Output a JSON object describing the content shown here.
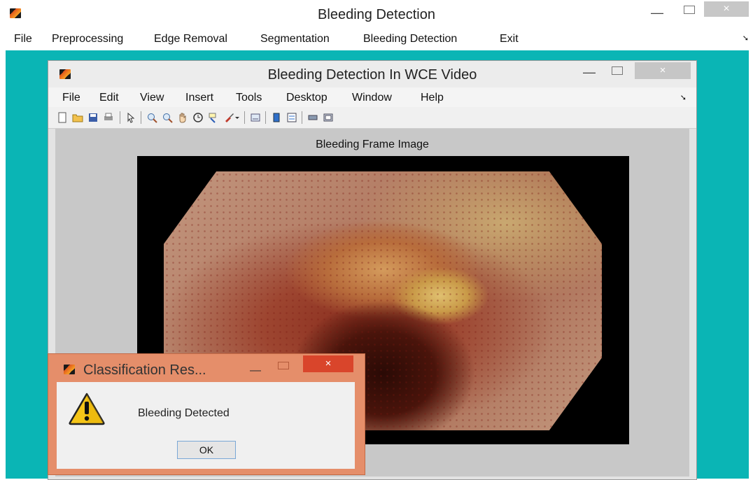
{
  "main_window": {
    "title": "Bleeding Detection",
    "close_glyph": "×",
    "minimize_glyph": "—",
    "menu": [
      "File",
      "Preprocessing",
      "Edge Removal",
      "Segmentation",
      "Bleeding Detection",
      "Exit"
    ],
    "overflow_glyph": "➘"
  },
  "figure_window": {
    "title": "Bleeding Detection In WCE Video",
    "close_glyph": "×",
    "minimize_glyph": "—",
    "menu": [
      "File",
      "Edit",
      "View",
      "Insert",
      "Tools",
      "Desktop",
      "Window",
      "Help"
    ],
    "overflow_glyph": "➘",
    "toolbar_icons": [
      "new-figure-icon",
      "open-file-icon",
      "save-icon",
      "print-icon",
      "select-arrow-icon",
      "zoom-in-icon",
      "zoom-out-icon",
      "pan-hand-icon",
      "rotate-3d-icon",
      "data-cursor-icon",
      "brush-icon",
      "colorbar-dropdown-icon",
      "link-plot-icon",
      "insert-colorbar-icon",
      "insert-legend-icon",
      "hide-plot-tools-icon",
      "show-plot-tools-icon"
    ],
    "axes_title": "Bleeding Frame  Image"
  },
  "dialog": {
    "title": "Classification Res...",
    "message": "Bleeding Detected",
    "ok_label": "OK",
    "close_glyph": "×",
    "minimize_glyph": "—"
  },
  "colors": {
    "desktop_teal": "#0ab5b5",
    "dialog_frame": "#e58e6a",
    "dialog_close": "#d9452b"
  }
}
